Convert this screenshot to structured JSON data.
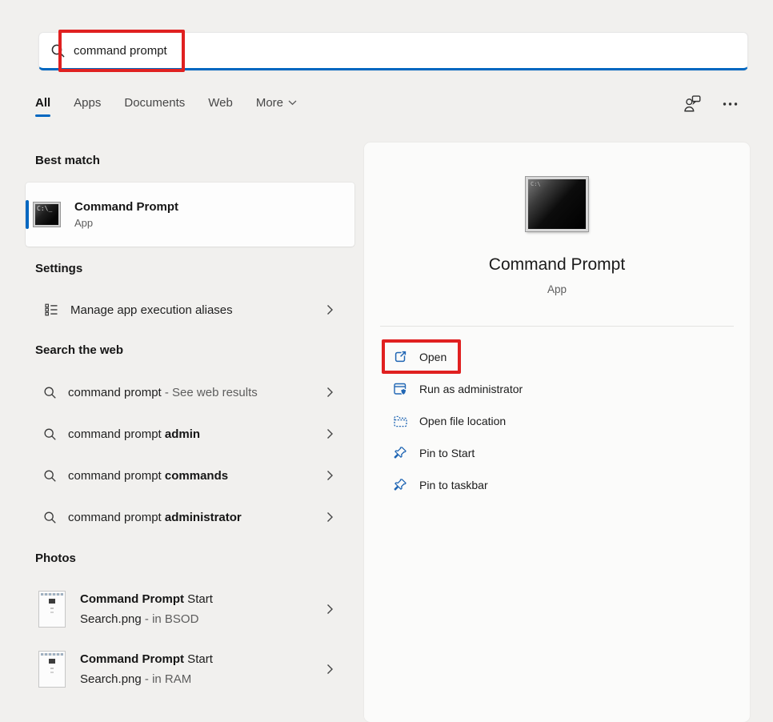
{
  "colors": {
    "accent": "#0067c0",
    "annotation_red": "#e02020",
    "icon_blue": "#2066b4"
  },
  "search": {
    "query": "command prompt"
  },
  "tabs": {
    "items": [
      "All",
      "Apps",
      "Documents",
      "Web",
      "More"
    ],
    "selected": "All"
  },
  "left": {
    "best_match": {
      "heading": "Best match",
      "app_name": "Command Prompt",
      "app_type": "App",
      "icon_text": "C:\\_"
    },
    "settings": {
      "heading": "Settings",
      "item": "Manage app execution aliases"
    },
    "web": {
      "heading": "Search the web",
      "items": [
        {
          "text": "command prompt",
          "suffix": " - See web results"
        },
        {
          "text": "command prompt ",
          "suffix": "admin"
        },
        {
          "text": "command prompt ",
          "suffix": "commands"
        },
        {
          "text": "command prompt ",
          "suffix": "administrator"
        }
      ]
    },
    "photos": {
      "heading": "Photos",
      "items": [
        {
          "bold": "Command Prompt",
          "rest": " Start",
          "file": "Search.png",
          "location": " - in BSOD"
        },
        {
          "bold": "Command Prompt",
          "rest": " Start",
          "file": "Search.png",
          "location": " - in RAM"
        }
      ]
    }
  },
  "right": {
    "app_name": "Command Prompt",
    "app_type": "App",
    "icon_text": "C:\\",
    "actions": [
      {
        "label": "Open"
      },
      {
        "label": "Run as administrator"
      },
      {
        "label": "Open file location"
      },
      {
        "label": "Pin to Start"
      },
      {
        "label": "Pin to taskbar"
      }
    ]
  }
}
